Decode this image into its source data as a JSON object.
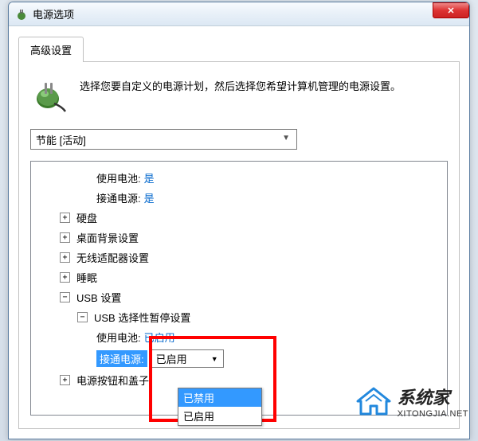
{
  "window": {
    "title": "电源选项"
  },
  "tab": {
    "label": "高级设置"
  },
  "description": "选择您要自定义的电源计划，然后选择您希望计算机管理的电源设置。",
  "plan_select": {
    "value": "节能 [活动]"
  },
  "tree": {
    "battery_use_label": "使用电池:",
    "battery_use_value": "是",
    "plugged_label": "接通电源:",
    "plugged_value": "是",
    "harddisk": "硬盘",
    "desktop_bg": "桌面背景设置",
    "wireless": "无线适配器设置",
    "sleep": "睡眠",
    "usb": "USB 设置",
    "usb_suspend": "USB 选择性暂停设置",
    "usb_battery_label": "使用电池:",
    "usb_battery_value": "已启用",
    "usb_plugged_label": "接通电源:",
    "usb_plugged_value": "已启用",
    "power_button": "电源按钮和盖子"
  },
  "dropdown": {
    "selected": "已启用",
    "option_disabled": "已禁用",
    "option_enabled": "已启用"
  },
  "expand": {
    "plus": "+",
    "minus": "−"
  },
  "watermark": {
    "name": "系统家",
    "url": "XITONGJIA.NET"
  }
}
